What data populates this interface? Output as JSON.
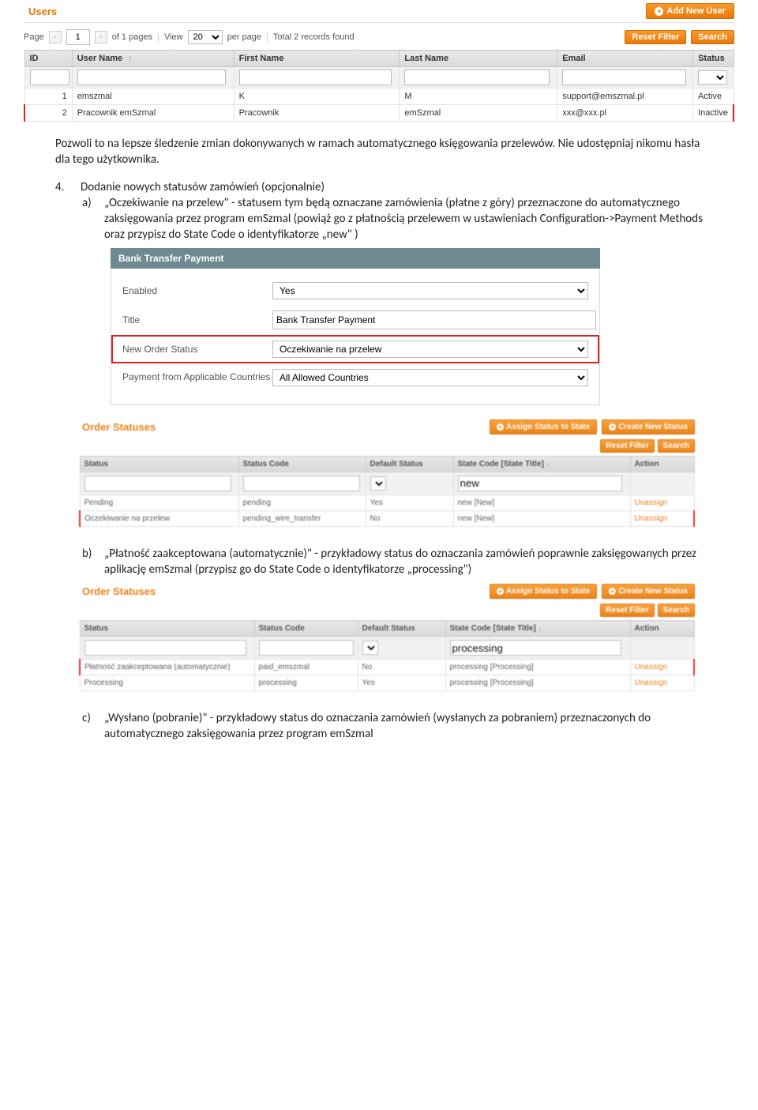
{
  "users_panel": {
    "title": "Users",
    "add_button": "Add New User",
    "toolbar": {
      "page_label": "Page",
      "page_value": "1",
      "of_pages": "of 1 pages",
      "view_label": "View",
      "view_value": "20",
      "per_page": "per page",
      "total": "Total 2 records found",
      "reset_filter": "Reset Filter",
      "search": "Search"
    },
    "columns": [
      "ID",
      "User Name",
      "First Name",
      "Last Name",
      "Email",
      "Status"
    ],
    "rows": [
      {
        "id": "1",
        "user": "emszmal",
        "first": "K",
        "last": "M",
        "email": "support@emszmal.pl",
        "status": "Active"
      },
      {
        "id": "2",
        "user": "Pracownik emSzmal",
        "first": "Pracownik",
        "last": "emSzmal",
        "email": "xxx@xxx.pl",
        "status": "Inactive"
      }
    ]
  },
  "doc": {
    "para1": "Pozwoli to na lepsze śledzenie zmian dokonywanych w ramach automatycznego księgowania przelewów. Nie udostępniaj nikomu hasła dla tego użytkownika.",
    "item4_num": "4.",
    "item4_text": "Dodanie nowych statusów zamówień (opcjonalnie)",
    "a_let": "a)",
    "a_text": "„Oczekiwanie na przelew\" - statusem tym będą oznaczane zamówienia (płatne z góry) przeznaczone do automatycznego zaksięgowania przez program emSzmal  (powiąż go z płatnością przelewem w ustawieniach Configuration->Payment Methods oraz przypisz do State Code  o identyfikatorze „new\" )",
    "b_let": "b)",
    "b_text": "„Płatność zaakceptowana (automatycznie)\"  - przykładowy status do oznaczania zamówień poprawnie zaksięgowanych przez aplikację emSzmal (przypisz go do State Code o identyfikatorze „processing\")",
    "c_let": "c)",
    "c_text": "„Wysłano (pobranie)\"  - przykładowy status do oznaczania zamówień (wysłanych za pobraniem) przeznaczonych do automatycznego zaksięgowania przez program emSzmal"
  },
  "payment_form": {
    "header": "Bank Transfer Payment",
    "rows": {
      "enabled_label": "Enabled",
      "enabled_value": "Yes",
      "title_label": "Title",
      "title_value": "Bank Transfer Payment",
      "new_order_label": "New Order Status",
      "new_order_value": "Oczekiwanie na przelew",
      "countries_label": "Payment from Applicable Countries",
      "countries_value": "All Allowed Countries"
    }
  },
  "os1": {
    "title": "Order Statuses",
    "btn_assign": "Assign Status to State",
    "btn_create": "Create New Status",
    "reset": "Reset Filter",
    "search": "Search",
    "cols": [
      "Status",
      "Status Code",
      "Default Status",
      "State Code [State Title]",
      "Action"
    ],
    "filter_state": "new",
    "rows": [
      {
        "status": "Pending",
        "code": "pending",
        "def": "Yes",
        "state": "new [New]",
        "action": "Unassign"
      },
      {
        "status": "Oczekiwanie na przelew",
        "code": "pending_wire_transfer",
        "def": "No",
        "state": "new [New]",
        "action": "Unassign"
      }
    ]
  },
  "os2": {
    "title": "Order Statuses",
    "btn_assign": "Assign Status to State",
    "btn_create": "Create New Status",
    "reset": "Reset Filter",
    "search": "Search",
    "cols": [
      "Status",
      "Status Code",
      "Default Status",
      "State Code [State Title]",
      "Action"
    ],
    "filter_state": "processing",
    "rows": [
      {
        "status": "Płatność zaakceptowana (automatycznie)",
        "code": "paid_emszmal",
        "def": "No",
        "state": "processing [Processing]",
        "action": "Unassign"
      },
      {
        "status": "Processing",
        "code": "processing",
        "def": "Yes",
        "state": "processing [Processing]",
        "action": "Unassign"
      }
    ]
  }
}
